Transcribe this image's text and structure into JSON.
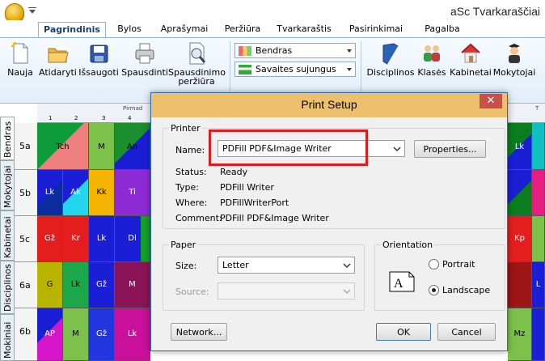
{
  "app": {
    "title": "aSc Tvarkaraščiai"
  },
  "menu_tabs": [
    "Pagrindinis",
    "Bylos",
    "Aprašymai",
    "Peržiūra",
    "Tvarkaraštis",
    "Pasirinkimai",
    "Pagalba"
  ],
  "ribbon": {
    "buttons": [
      {
        "label": "Nauja",
        "icon": "new-document-icon"
      },
      {
        "label": "Atidaryti",
        "icon": "open-folder-icon"
      },
      {
        "label": "Išsaugoti",
        "icon": "save-disk-icon"
      },
      {
        "label": "Spausdinti",
        "icon": "printer-icon"
      },
      {
        "label": "Spausdinimo",
        "label2": "peržiūra",
        "icon": "print-preview-icon"
      },
      {
        "label": "Disciplinos",
        "icon": "book-icon"
      },
      {
        "label": "Klasės",
        "icon": "people-icon"
      },
      {
        "label": "Kabinetai",
        "icon": "house-icon"
      },
      {
        "label": "Mokytojai",
        "icon": "teacher-icon"
      }
    ],
    "view_dropdown": "Bendras",
    "view_dropdown2": "Savaites sujungus"
  },
  "side_tabs": [
    "Bendras",
    "Mokytojai",
    "Kabinetai",
    "Disciplinos",
    "Mokiniai"
  ],
  "grid": {
    "day_label": "Pirmad",
    "day_label_right": "T",
    "periods": [
      "1",
      "2",
      "3",
      "4"
    ],
    "rows": [
      {
        "class": "5a",
        "cells": [
          "Tch",
          "",
          "M",
          "An"
        ],
        "right": "Lk"
      },
      {
        "class": "5b",
        "cells": [
          "Lk",
          "Ak",
          "Kk",
          "Ti"
        ],
        "right": ""
      },
      {
        "class": "5c",
        "cells": [
          "Gž",
          "Kr",
          "Lk",
          "Dl"
        ],
        "right": "Kp"
      },
      {
        "class": "6a",
        "cells": [
          "G",
          "Lk",
          "Gž",
          "M"
        ],
        "right": "L"
      },
      {
        "class": "6b",
        "cells": [
          "AP",
          "M",
          "Gž",
          "Lk"
        ],
        "right": "Mz"
      }
    ]
  },
  "dialog": {
    "title": "Print Setup",
    "close_symbol": "✕",
    "printer_group": "Printer",
    "name_label": "Name:",
    "printer_name": "PDFill PDF&Image Writer",
    "properties_button": "Properties...",
    "status_label": "Status:",
    "status_value": "Ready",
    "type_label": "Type:",
    "type_value": "PDFill Writer",
    "where_label": "Where:",
    "where_value": "PDFillWriterPort",
    "comment_label": "Comment:",
    "comment_value": "PDFill PDF&Image Writer",
    "paper_group": "Paper",
    "size_label": "Size:",
    "size_value": "Letter",
    "source_label": "Source:",
    "source_value": "",
    "orientation_group": "Orientation",
    "portrait_label": "Portrait",
    "landscape_label": "Landscape",
    "orientation_selected": "Landscape",
    "network_button": "Network...",
    "ok_button": "OK",
    "cancel_button": "Cancel",
    "highlight_color": "#e11b1b"
  }
}
